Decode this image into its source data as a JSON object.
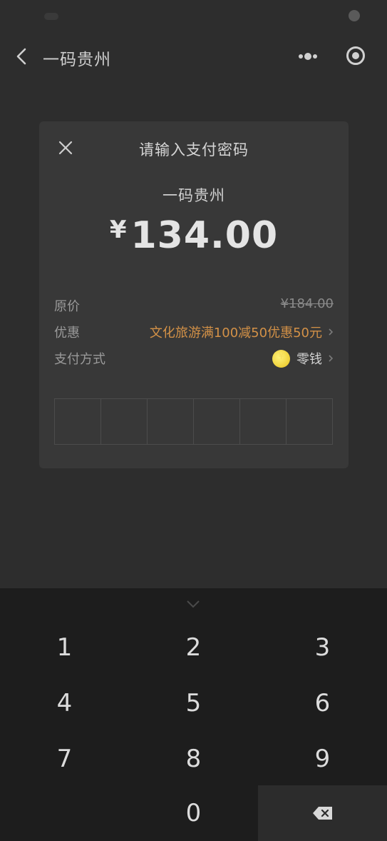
{
  "nav": {
    "title": "一码贵州"
  },
  "dialog": {
    "title": "请输入支付密码",
    "merchant": "一码贵州",
    "currency_symbol": "¥",
    "amount": "134.00",
    "rows": {
      "original_price_label": "原价",
      "original_price_value": "¥184.00",
      "discount_label": "优惠",
      "discount_value": "文化旅游满100减50优惠50元",
      "payment_method_label": "支付方式",
      "payment_method_value": "零钱"
    },
    "password_cells": 6
  },
  "keyboard": {
    "keys": [
      "1",
      "2",
      "3",
      "4",
      "5",
      "6",
      "7",
      "8",
      "9",
      "0"
    ]
  },
  "colors": {
    "background": "#2d2d2d",
    "dialog": "#383838",
    "keyboard": "#1d1d1d",
    "accent_orange": "#d39147",
    "coin": "#f0cf2a"
  },
  "icons": {
    "back": "back-arrow-icon",
    "more": "more-dots-icon",
    "target": "target-icon",
    "close": "close-icon",
    "collapse": "chevron-down-icon",
    "delete": "backspace-icon"
  }
}
